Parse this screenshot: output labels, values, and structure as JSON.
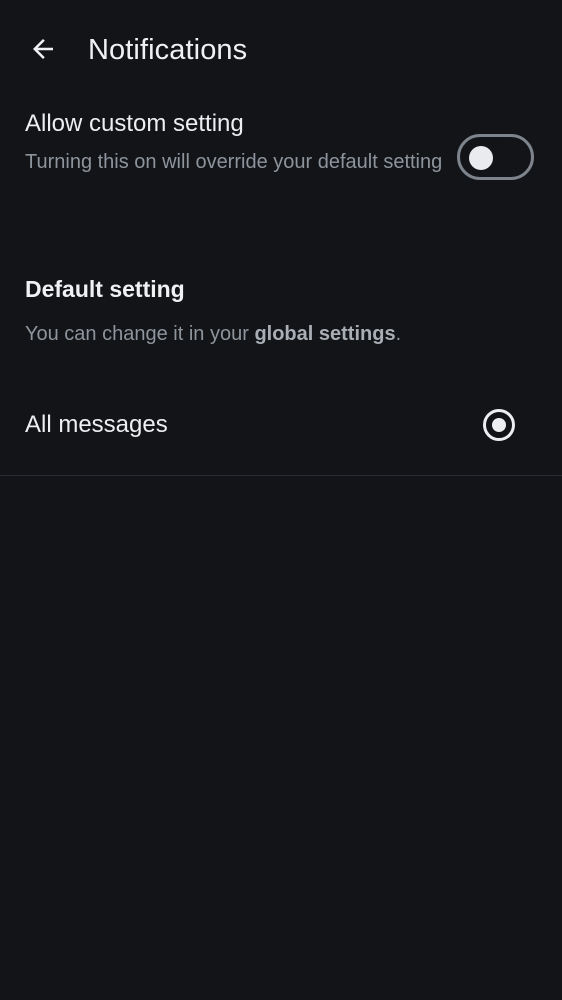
{
  "header": {
    "back_icon": "arrow-left-icon",
    "title": "Notifications"
  },
  "custom_setting": {
    "title": "Allow custom setting",
    "description": "Turning this on will override your default setting",
    "toggle_on": false
  },
  "default_setting": {
    "heading": "Default setting",
    "description_prefix": "You can change it in your ",
    "description_link": "global settings",
    "description_suffix": "."
  },
  "options": {
    "all_messages_label": "All messages",
    "all_messages_selected": true
  },
  "colors": {
    "background": "#121418",
    "primary_text": "#EDEEF0",
    "secondary_text": "#8E949C"
  }
}
